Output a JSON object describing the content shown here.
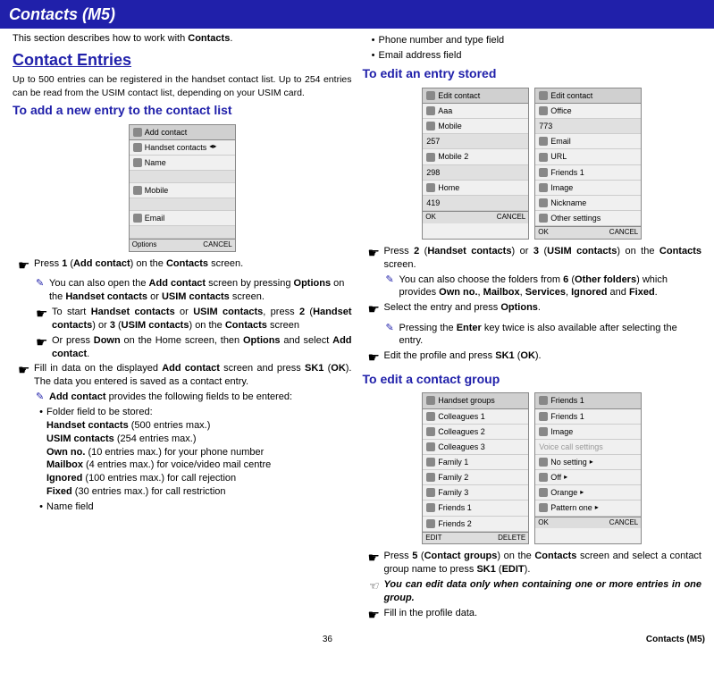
{
  "header": "Contacts (M5)",
  "intro": "This section describes how to work with ",
  "intro_b": "Contacts",
  "h1": "Contact Entries",
  "subintro": "Up to 500 entries can be registered in the handset contact list. Up to 254 entries can be read from the USIM contact list, depending on your USIM card.",
  "h2_add": "To add a new entry to the contact list",
  "add_screen": {
    "title": "Add contact",
    "r1": "Handset contacts",
    "r2": "Name",
    "r3": "Mobile",
    "r4": "Email",
    "foot_l": "Options",
    "foot_r": "CANCEL"
  },
  "add_p1a": "Press ",
  "add_p1b": "1",
  "add_p1c": " (",
  "add_p1d": "Add contact",
  "add_p1e": ") on the ",
  "add_p1f": "Contacts",
  "add_p1g": " screen.",
  "add_sub1a": "You can also open the ",
  "add_sub1b": "Add contact",
  "add_sub1c": " screen by pressing ",
  "add_sub1d": "Options",
  "add_sub1e": " on the ",
  "add_sub1f": "Handset contacts",
  "add_sub1g": " or ",
  "add_sub1h": "USIM contacts",
  "add_sub1i": " screen.",
  "add_deep1a": "To start ",
  "add_deep1b": "Handset contacts",
  "add_deep1c": " or ",
  "add_deep1d": "USIM contacts",
  "add_deep1e": ", press ",
  "add_deep1f": "2",
  "add_deep1g": " (",
  "add_deep1h": "Handset contacts",
  "add_deep1i": ") or ",
  "add_deep1j": "3",
  "add_deep1k": " (",
  "add_deep1l": "USIM contacts",
  "add_deep1m": ") on the ",
  "add_deep1n": "Contacts",
  "add_deep1o": " screen",
  "add_deep2a": "Or press ",
  "add_deep2b": "Down",
  "add_deep2c": " on the Home screen, then ",
  "add_deep2d": "Options",
  "add_deep2e": " and select ",
  "add_deep2f": "Add contact",
  "add_deep2g": ".",
  "add_p2a": "Fill in data on the displayed ",
  "add_p2b": "Add contact",
  "add_p2c": " screen and press ",
  "add_p2d": "SK1",
  "add_p2e": " (",
  "add_p2f": "OK",
  "add_p2g": "). The data you entered is saved as a contact entry.",
  "add_sub2a": "Add contact",
  "add_sub2b": " provides the following fields to be entered:",
  "folder_label": "Folder field to be stored:",
  "fl1a": "Handset contacts",
  "fl1b": " (500 entries max.)",
  "fl2a": "USIM contacts",
  "fl2b": " (254 entries max.)",
  "fl3a": "Own no.",
  "fl3b": " (10 entries max.) for your phone number",
  "fl4a": "Mailbox",
  "fl4b": " (4 entries max.) for voice/video mail centre",
  "fl5a": "Ignored",
  "fl5b": " (100 entries max.) for call rejection",
  "fl6a": "Fixed",
  "fl6b": " (30 entries max.) for call restriction",
  "bullet_name": "Name field",
  "bullet_phone": "Phone number and type field",
  "bullet_email": "Email address field",
  "h2_edit": "To edit an entry stored",
  "edit_s1": {
    "title": "Edit contact",
    "r1": "Aaa",
    "r2": "Mobile",
    "r2v": "257",
    "r3": "Mobile 2",
    "r3v": "298",
    "r4": "Home",
    "r4v": "419",
    "foot_l": "OK",
    "foot_r": "CANCEL"
  },
  "edit_s2": {
    "title": "Edit contact",
    "r1": "Office",
    "r1v": "773",
    "r2": "Email",
    "r3": "URL",
    "r4": "Friends 1",
    "r5": "Image",
    "r6": "Nickname",
    "r7": "Other settings",
    "foot_l": "OK",
    "foot_r": "CANCEL"
  },
  "edit_p1a": "Press ",
  "edit_p1b": "2",
  "edit_p1c": " (",
  "edit_p1d": "Handset contacts",
  "edit_p1e": ") or ",
  "edit_p1f": "3",
  "edit_p1g": " (",
  "edit_p1h": "USIM contacts",
  "edit_p1i": ") on the ",
  "edit_p1j": "Contacts",
  "edit_p1k": " screen.",
  "edit_sub1a": "You can also choose the folders from ",
  "edit_sub1b": "6",
  "edit_sub1c": " (",
  "edit_sub1d": "Other folders",
  "edit_sub1e": ") which provides ",
  "edit_sub1f": "Own no.",
  "edit_sub1g": ", ",
  "edit_sub1h": "Mailbox",
  "edit_sub1i": ", ",
  "edit_sub1j": "Services",
  "edit_sub1k": ", ",
  "edit_sub1l": "Ignored",
  "edit_sub1m": " and ",
  "edit_sub1n": "Fixed",
  "edit_sub1o": ".",
  "edit_p2a": "Select the entry and press ",
  "edit_p2b": "Options",
  "edit_p2c": ".",
  "edit_sub2a": "Pressing the ",
  "edit_sub2b": "Enter",
  "edit_sub2c": " key twice is also available after selecting the entry.",
  "edit_p3a": "Edit the profile and press ",
  "edit_p3b": "SK1",
  "edit_p3c": " (",
  "edit_p3d": "OK",
  "edit_p3e": ").",
  "h2_group": "To edit a contact group",
  "grp_s1": {
    "title": "Handset groups",
    "r1": "Colleagues 1",
    "r2": "Colleagues 2",
    "r3": "Colleagues 3",
    "r4": "Family 1",
    "r5": "Family 2",
    "r6": "Family 3",
    "r7": "Friends 1",
    "r8": "Friends 2",
    "foot_l": "EDIT",
    "foot_r": "DELETE"
  },
  "grp_s2": {
    "title": "Friends 1",
    "r1": "Friends 1",
    "r2": "Image",
    "sect": "Voice call settings",
    "r3": "No setting",
    "r4": "Off",
    "r5": "Orange",
    "r6": "Pattern one",
    "foot_l": "OK",
    "foot_r": "CANCEL"
  },
  "grp_p1a": "Press ",
  "grp_p1b": "5",
  "grp_p1c": " (",
  "grp_p1d": "Contact groups",
  "grp_p1e": ") on the ",
  "grp_p1f": "Contacts",
  "grp_p1g": " screen and select a contact group name to press ",
  "grp_p1h": "SK1",
  "grp_p1i": " (",
  "grp_p1j": "EDIT",
  "grp_p1k": ").",
  "grp_note": "You can edit data only when containing one or more entries in one group.",
  "grp_p2": "Fill in the profile data.",
  "footer_page": "36",
  "footer_sect": "Contacts (M5)"
}
